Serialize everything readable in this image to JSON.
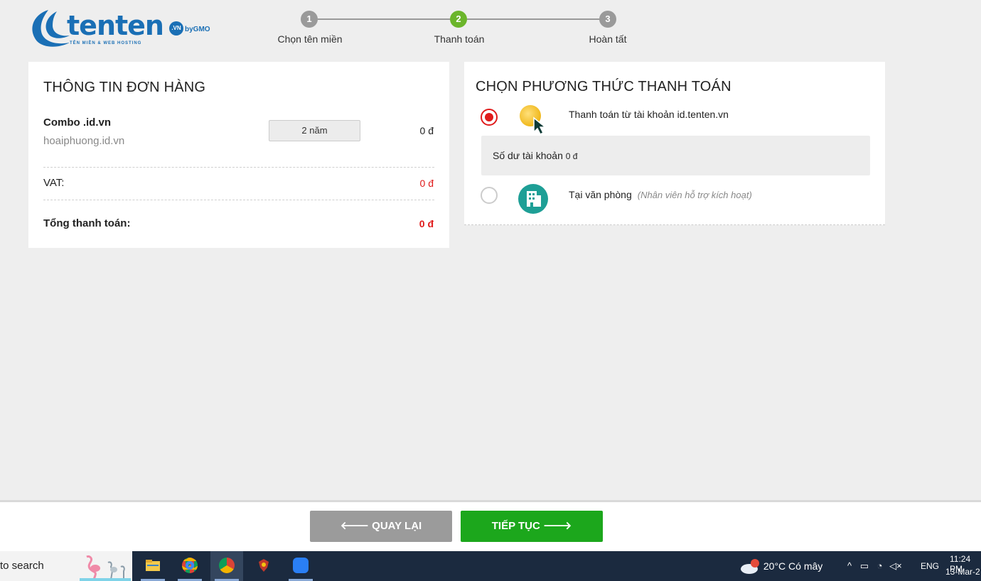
{
  "header": {
    "brand": "tenten",
    "brand_suffix": ".VN",
    "brand_by": "byGMO",
    "tagline": "TÊN MIỀN & WEB HOSTING",
    "steps": [
      {
        "number": "1",
        "label": "Chọn tên miền",
        "state": "done"
      },
      {
        "number": "2",
        "label": "Thanh toán",
        "state": "active"
      },
      {
        "number": "3",
        "label": "Hoàn tất",
        "state": "pending"
      }
    ]
  },
  "order": {
    "title": "THÔNG TIN ĐƠN HÀNG",
    "item_name": "Combo .id.vn",
    "item_domain": "hoaiphuong.id.vn",
    "period": "2 năm",
    "item_price": "0 đ",
    "vat_label": "VAT:",
    "vat_value": "0 đ",
    "total_label": "Tổng thanh toán:",
    "total_value": "0 đ"
  },
  "payment": {
    "title": "CHỌN PHƯƠNG THỨC THANH TOÁN",
    "methods": [
      {
        "label": "Thanh toán từ tài khoản id.tenten.vn",
        "selected": true,
        "icon": "coin-icon"
      },
      {
        "label": "Tại văn phòng",
        "note": "(Nhân viên hỗ trợ kích hoạt)",
        "selected": false,
        "icon": "office-building-icon"
      }
    ],
    "balance_label": "Số dư tài khoản",
    "balance_value": "0 đ"
  },
  "actions": {
    "back_label": "🡐 QUAY LẠI",
    "next_label": "TIẾP TỤC 🡒"
  },
  "taskbar": {
    "search_text": "to search",
    "weather_badge": "1",
    "weather": "20°C  Có mây",
    "language": "ENG",
    "time": "11:24 PM",
    "date": "13-Mar-2"
  },
  "colors": {
    "brand_blue": "#1a6fb5",
    "step_active": "#6bb52b",
    "step_inactive": "#9a9a9a",
    "price_red": "#e01b1b",
    "next_green": "#1ca71c",
    "back_gray": "#9b9b9b"
  }
}
